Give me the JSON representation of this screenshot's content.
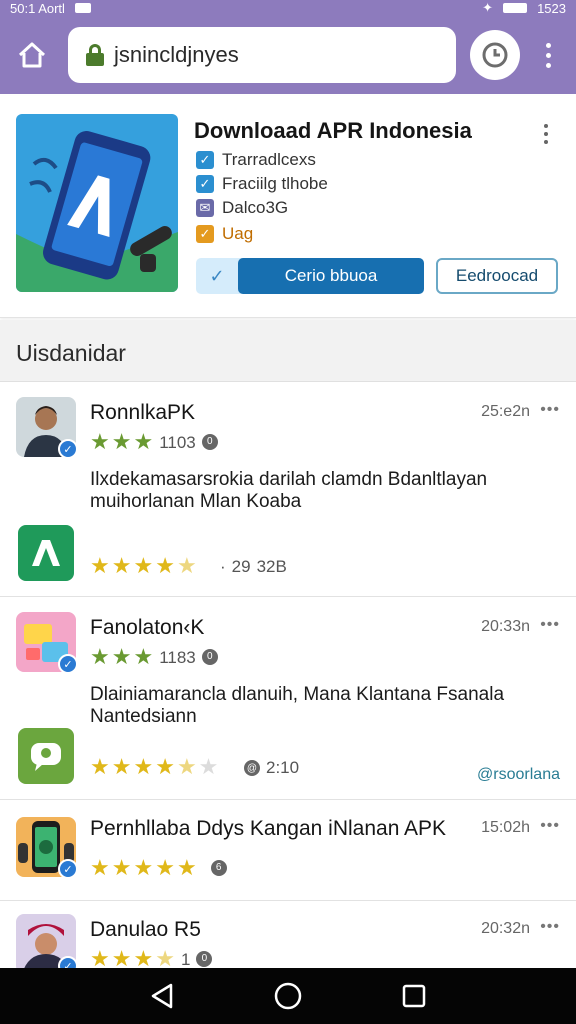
{
  "status_bar": {
    "left_text": "50:1 Aortl",
    "time": "1523"
  },
  "browser": {
    "url": "jsnincldjnyes"
  },
  "app": {
    "title": "Downloaad APR Indonesia",
    "features": [
      {
        "label": "Trarradlcexs",
        "color": "#2b8fd0",
        "icon": "check-icon"
      },
      {
        "label": "Fraciilg tlhobe",
        "color": "#2b8fd0",
        "icon": "check-icon"
      },
      {
        "label": "Dalco3G",
        "color": "#6a6aa8",
        "icon": "mail-icon"
      },
      {
        "label": "Uag",
        "color": "#e49a1f",
        "icon": "check-icon"
      }
    ],
    "primary_button": "Cerio  bbuoa",
    "secondary_button": "Eedroocad"
  },
  "section": {
    "title": "Uisdanidar"
  },
  "entries": [
    {
      "name": "RonnlkaPK",
      "time": "25:e2n",
      "rating_count": "1103",
      "rating": 3,
      "description": "Ilxdekamasarsrokia darilah clamdn Bdanltlayan muihorlanan Mlan Koaba",
      "meta_dot": "·",
      "meta_value": "29",
      "meta_value2": "32B",
      "app_stars": 4.5
    },
    {
      "name": "Fanolaton‹K",
      "time": "20:33n",
      "rating_count": "1183",
      "rating": 3,
      "description": "Dlainiamarancla dlanuih, Mana Klantana Fsanala Nantedsiann",
      "meta_value": "2:10",
      "app_stars": 4.5,
      "link": "@rsoorlana"
    },
    {
      "name": "Pernhllaba Ddys Kangan iNlanan APK",
      "time": "15:02h",
      "rating": 5
    },
    {
      "name": "Danulao R5",
      "time": "20:32n",
      "rating_count": "1",
      "rating": 4
    }
  ],
  "colors": {
    "toolbar": "#8d7bbd",
    "accent": "#176fb0",
    "star": "#e0b81a"
  }
}
